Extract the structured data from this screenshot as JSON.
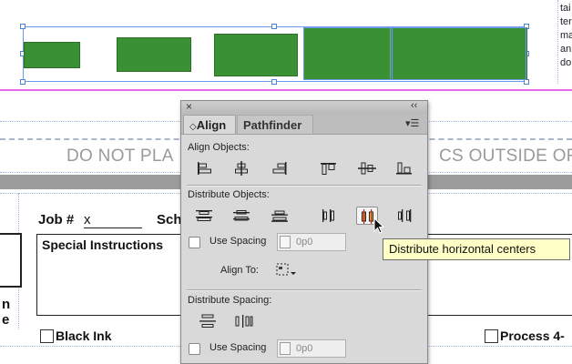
{
  "background": {
    "banner": {
      "left_text": "DO NOT PLA",
      "right_text": "CS OUTSIDE OF"
    },
    "right_column_fragments": [
      "tai",
      "ter",
      "ma",
      "an",
      "do"
    ],
    "form": {
      "job_label": "Job #",
      "job_value": "x",
      "sch_fragment": "Sch",
      "special_instructions_label": "Special Instructions",
      "black_ink_label": "Black Ink",
      "process_label": "Process 4-",
      "left_fragments": [
        "n",
        "e"
      ]
    },
    "colors": {
      "shape_green": "#3a9134",
      "guide_magenta": "#e46be4",
      "selection_blue": "#6b9be6"
    }
  },
  "panel": {
    "close_glyph": "×",
    "collapse_glyph": "‹‹",
    "tabs": [
      {
        "label": "Align",
        "prefix": "◇",
        "active": true
      },
      {
        "label": "Pathfinder",
        "active": false
      }
    ],
    "menu_glyph": "▾☰",
    "align_objects": {
      "title": "Align Objects:",
      "buttons": [
        {
          "icon": "align-left-edges-icon"
        },
        {
          "icon": "align-horizontal-centers-icon"
        },
        {
          "icon": "align-right-edges-icon"
        },
        {
          "icon": "align-top-edges-icon"
        },
        {
          "icon": "align-vertical-centers-icon"
        },
        {
          "icon": "align-bottom-edges-icon"
        }
      ]
    },
    "distribute_objects": {
      "title": "Distribute Objects:",
      "buttons": [
        {
          "icon": "distribute-top-edges-icon"
        },
        {
          "icon": "distribute-vertical-centers-icon"
        },
        {
          "icon": "distribute-bottom-edges-icon"
        },
        {
          "icon": "distribute-left-edges-icon"
        },
        {
          "icon": "distribute-horizontal-centers-icon",
          "pressed": true
        },
        {
          "icon": "distribute-right-edges-icon"
        }
      ],
      "use_spacing_label": "Use Spacing",
      "spacing_value": "0p0",
      "align_to_label": "Align To:"
    },
    "distribute_spacing": {
      "title": "Distribute Spacing:",
      "use_spacing_label": "Use Spacing",
      "spacing_value": "0p0"
    }
  },
  "tooltip": {
    "text": "Distribute horizontal centers"
  }
}
